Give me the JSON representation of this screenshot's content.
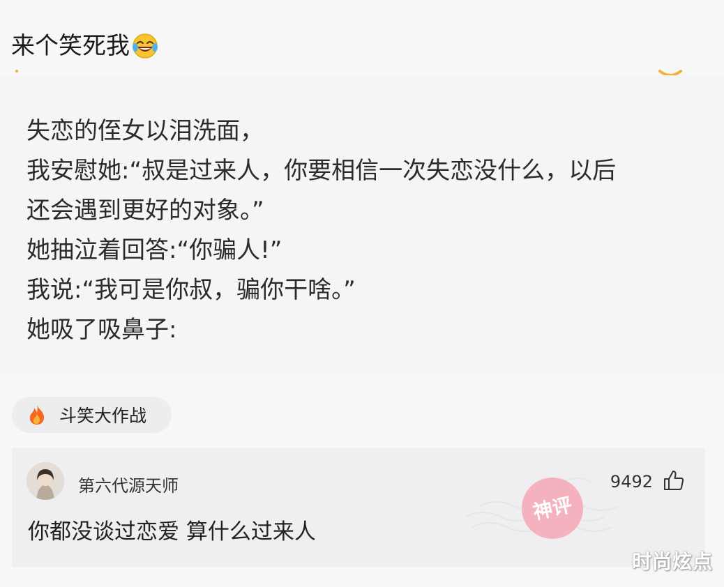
{
  "post": {
    "title": "来个笑死我",
    "title_emoji": "rolling-laughing-emoji",
    "body_lines": [
      "失恋的侄女以泪洗面，",
      "我安慰她:“叔是过来人，你要相信一次失恋没什么，以后",
      "还会遇到更好的对象。”",
      "她抽泣着回答:“你骗人!”",
      "我说:“我可是你叔，骗你干啥。”",
      "她吸了吸鼻子:"
    ]
  },
  "topic": {
    "icon": "fire-icon",
    "label": "斗笑大作战"
  },
  "comment": {
    "author": "第六代源天师",
    "likes": "9492",
    "text": "你都没谈过恋爱 算什么过来人",
    "badge": "神评",
    "like_icon": "thumbs-up-icon"
  },
  "watermark": "时尚炫点",
  "colors": {
    "background": "#f7f7f8",
    "chip": "#ededef",
    "comment_card": "#efeff1",
    "stamp": "#f3a0b0"
  }
}
